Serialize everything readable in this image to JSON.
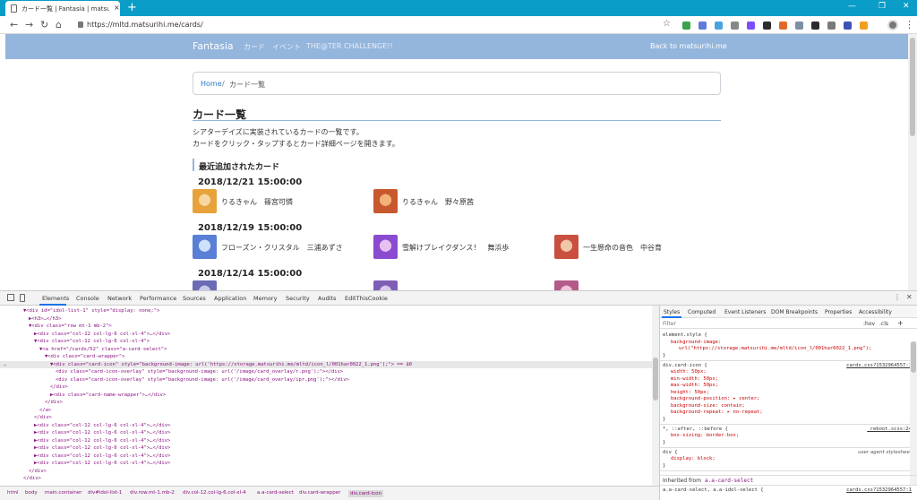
{
  "browser": {
    "tab_title": "カード一覧 | Fantasia | matsurihi.me",
    "tab_close": "×",
    "new_tab": "+",
    "window_controls": [
      "—",
      "❐",
      "✕"
    ],
    "nav": {
      "back": "←",
      "forward": "→",
      "reload": "↻",
      "home": "⌂"
    },
    "url": "https://mltd.matsurihi.me/cards/",
    "star": "☆",
    "menu": "⋮",
    "extension_colors": [
      "#3aa34b",
      "#5f7ad8",
      "#4aa3df",
      "#888888",
      "#7c4dff",
      "#2d2d2d",
      "#e06a2a",
      "#7c8fa3",
      "#2b2b2b",
      "#7a7a7a",
      "#3f51b5",
      "#f0a020"
    ]
  },
  "site": {
    "brand": "Fantasia",
    "nav_links": [
      "カード",
      "イベント",
      "THE@TER CHALLENGE!!"
    ],
    "back_link": "Back to matsurihi.me"
  },
  "breadcrumb": {
    "home": "Home",
    "separator": "/",
    "current": "カード一覧"
  },
  "main": {
    "title": "カード一覧",
    "description": [
      "シアターデイズに実装されているカードの一覧です。",
      "カードをクリック・タップするとカード詳細ページを開きます。"
    ],
    "section_title": "最近追加されたカード",
    "groups": [
      {
        "date": "2018/12/21 15:00:00",
        "cards": [
          {
            "name": "りるきゃん　篠宮可憐",
            "colors": [
              "#e8a23a",
              "#f6d7a1"
            ]
          },
          {
            "name": "りるきゃん　野々原茜",
            "colors": [
              "#c8582e",
              "#f3b27a"
            ]
          }
        ]
      },
      {
        "date": "2018/12/19 15:00:00",
        "cards": [
          {
            "name": "フローズン・クリスタル　三浦あずさ",
            "colors": [
              "#5a7fd6",
              "#cfe0fb"
            ]
          },
          {
            "name": "雪解けブレイクダンス！　舞浜歩",
            "colors": [
              "#8a4bd0",
              "#e7c2f0"
            ]
          },
          {
            "name": "一生懸命の音色　中谷育",
            "colors": [
              "#c9503f",
              "#f2c7a8"
            ]
          }
        ]
      },
      {
        "date": "2018/12/14 15:00:00",
        "cards": [
          {
            "name": "",
            "colors": [
              "#6b6bb6",
              "#c9c9ea"
            ]
          },
          {
            "name": "",
            "colors": [
              "#7f5fb6",
              "#d8c9ee"
            ]
          },
          {
            "name": "",
            "colors": [
              "#b35a8a",
              "#efc6dc"
            ]
          }
        ]
      }
    ]
  },
  "devtools": {
    "tabs": [
      "Elements",
      "Console",
      "Network",
      "Performance",
      "Sources",
      "Application",
      "Memory",
      "Security",
      "Audits",
      "EditThisCookie"
    ],
    "more": "⋮",
    "close": "✕",
    "dom_lines": [
      {
        "indent": 0,
        "text": "▼<div id=\"idol-list-1\" style=\"display: none;\">"
      },
      {
        "indent": 1,
        "text": "▶<h3>…</h3>"
      },
      {
        "indent": 1,
        "text": "▼<div class=\"row mt-1 mb-2\">"
      },
      {
        "indent": 2,
        "text": "▶<div class=\"col-12 col-lg-6 col-xl-4\">…</div>"
      },
      {
        "indent": 2,
        "text": "▼<div class=\"col-12 col-lg-6 col-xl-4\">"
      },
      {
        "indent": 3,
        "text": "▼<a href=\"/cards/52\" class=\"a-card-select\">"
      },
      {
        "indent": 4,
        "text": "▼<div class=\"card-wrapper\">"
      },
      {
        "indent": 5,
        "text": "▼<div class=\"card-icon\" style=\"background-image: url('https://storage.matsurihi.me/mltd/icon_l/001har0022_1.png');\"> == $0",
        "selected": true
      },
      {
        "indent": 6,
        "text": "<div class=\"card-icon-overlay\" style=\"background-image: url('/image/card_overlay/r.png');\"></div>"
      },
      {
        "indent": 6,
        "text": "<div class=\"card-icon-overlay\" style=\"background-image: url('/image/card_overlay/ipr.png');\"></div>"
      },
      {
        "indent": 5,
        "text": "</div>"
      },
      {
        "indent": 5,
        "text": "▶<div class=\"card-name-wrapper\">…</div>"
      },
      {
        "indent": 4,
        "text": "</div>"
      },
      {
        "indent": 3,
        "text": "</a>"
      },
      {
        "indent": 2,
        "text": "</div>"
      },
      {
        "indent": 2,
        "text": "▶<div class=\"col-12 col-lg-6 col-xl-4\">…</div>"
      },
      {
        "indent": 2,
        "text": "▶<div class=\"col-12 col-lg-6 col-xl-4\">…</div>"
      },
      {
        "indent": 2,
        "text": "▶<div class=\"col-12 col-lg-6 col-xl-4\">…</div>"
      },
      {
        "indent": 2,
        "text": "▶<div class=\"col-12 col-lg-6 col-xl-4\">…</div>"
      },
      {
        "indent": 2,
        "text": "▶<div class=\"col-12 col-lg-6 col-xl-4\">…</div>"
      },
      {
        "indent": 2,
        "text": "▶<div class=\"col-12 col-lg-6 col-xl-4\">…</div>"
      },
      {
        "indent": 1,
        "text": "</div>"
      },
      {
        "indent": 0,
        "text": "</div>"
      }
    ],
    "dom_ellipsis": "…",
    "breadcrumbs": [
      "html",
      "body",
      "main.container",
      "div#idol-list-1",
      "div.row.mt-1.mb-2",
      "div.col-12.col-lg-6.col-xl-4",
      "a.a-card-select",
      "div.card-wrapper",
      "div.card-icon"
    ],
    "styles": {
      "tabs": [
        "Styles",
        "Computed",
        "Event Listeners",
        "DOM Breakpoints",
        "Properties",
        "Accessibility"
      ],
      "filter_placeholder": "Filter",
      "hov": ":hov",
      "cls": ".cls",
      "add": "+",
      "rules": [
        {
          "selector": "element.style {",
          "source": "",
          "lines": [
            "background-image:",
            "url(\"https://storage.matsurihi.me/mltd/icon_l/001har0022_1.png\");"
          ],
          "close": "}"
        },
        {
          "selector": "div.card-icon {",
          "source": "cards.css?1532964557:1",
          "lines": [
            "width: 50px;",
            "min-width: 50px;",
            "max-width: 50px;",
            "height: 50px;",
            "background-position: ▸ center;",
            "background-size: contain;",
            "background-repeat: ▸ no-repeat;"
          ],
          "close": "}"
        },
        {
          "selector": "*, ::after, ::before {",
          "source": "_reboot.scss:24",
          "lines": [
            "box-sizing: border-box;"
          ],
          "close": "}"
        },
        {
          "selector": "div {",
          "source": "user agent stylesheet",
          "lines": [
            "display: block;"
          ],
          "close": "}"
        }
      ],
      "inherited_label": "Inherited from",
      "inherited_from": "a.a-card-select",
      "inherited_selector": "a.a-card-select, a.a-idol-select {",
      "inherited_source": "cards.css?1532964557:1"
    }
  }
}
